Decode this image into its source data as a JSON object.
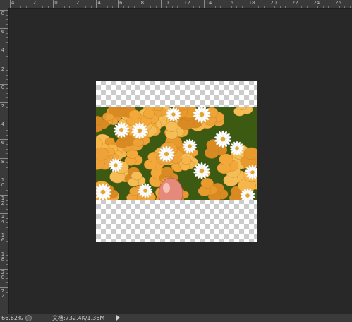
{
  "rulers": {
    "top_labels": [
      "4",
      "2",
      "0",
      "2",
      "4",
      "6",
      "8",
      "10",
      "12",
      "14",
      "16",
      "18",
      "20",
      "22",
      "24",
      "26"
    ],
    "left_labels": [
      "8",
      "6",
      "4",
      "2",
      "0",
      "2",
      "4",
      "6",
      "8",
      "10",
      "12",
      "14",
      "16",
      "18",
      "20",
      "22"
    ]
  },
  "status": {
    "zoom": "66.62%",
    "doc_info": "文档:732.4K/1.36M"
  },
  "icons": {
    "status_icon": "circle-icon",
    "menu_arrow": "triangle-right-icon"
  },
  "colors": {
    "workspace": "#282828",
    "ruler": "#3a3a3a",
    "checker_light": "#ffffff",
    "checker_dark": "#cccccc",
    "flower_orange": "#f0a93a",
    "foliage": "#3c5a12"
  }
}
